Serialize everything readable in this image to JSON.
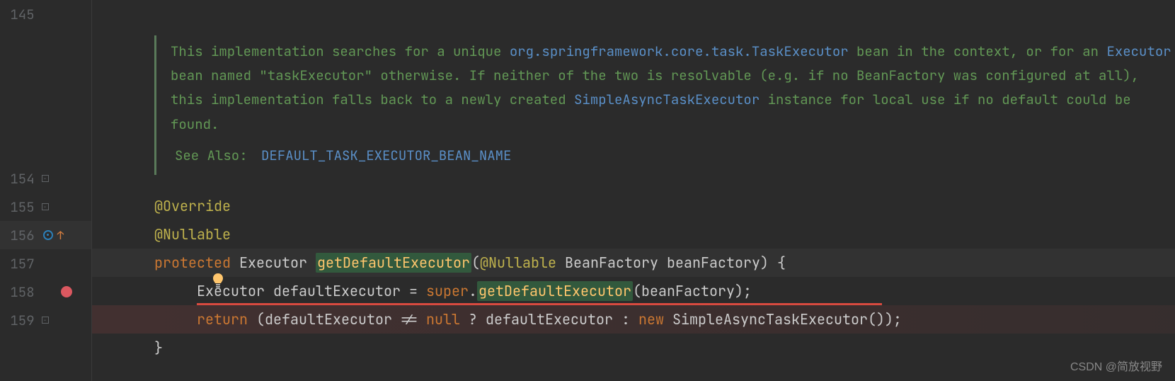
{
  "lines": {
    "l145": "145",
    "l154": "154",
    "l155": "155",
    "l156": "156",
    "l157": "157",
    "l158": "158",
    "l159": "159"
  },
  "doc": {
    "text1": "This implementation searches for a unique ",
    "link1": "org.springframework.core.task.TaskExecutor",
    "text2": " bean in the context, or for an ",
    "link2": "Executor",
    "text3": " bean named \"taskExecutor\" otherwise. If neither of the two is resolvable (e.g. if no BeanFactory was configured at all), this implementation falls back to a newly created ",
    "link3": "SimpleAsyncTaskExecutor",
    "text4": " instance for local use if no default could be found.",
    "seealso_label": "See Also:",
    "seealso_link": "DEFAULT_TASK_EXECUTOR_BEAN_NAME"
  },
  "code": {
    "override": "@Override",
    "nullable": "@Nullable",
    "protected": "protected",
    "executor_type": "Executor",
    "method_name": "getDefaultExecutor",
    "nullable_param": "@Nullable",
    "beanfactory_type": "BeanFactory",
    "beanfactory_param": "beanFactory",
    "paren_open": "(",
    "paren_close": ")",
    "brace_open": " {",
    "default_exec_var": "defaultExecutor",
    "equals": " = ",
    "super_kw": "super",
    "dot": ".",
    "semicolon": ";",
    "return_kw": "return",
    "neq_null": " != ",
    "null_kw": "null",
    "question": " ? ",
    "colon": " : ",
    "new_kw": "new",
    "simple_async": "SimpleAsyncTaskExecutor",
    "empty_parens": "()",
    "brace_close": "}"
  },
  "icons": {
    "bulb": "bulb-icon",
    "override": "override-icon",
    "breakpoint": "breakpoint-icon",
    "fold_minus": "fold-minus-icon"
  },
  "watermark": "CSDN @简放视野"
}
